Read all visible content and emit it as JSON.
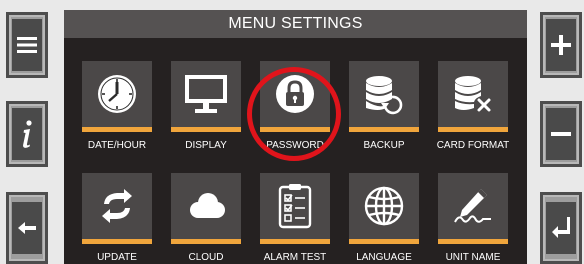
{
  "title": "MENU SETTINGS",
  "colors": {
    "accent_bar": "#f0a53c",
    "highlight_ring": "#e0141b",
    "screen_background": "#252121",
    "tile_background": "#4b4848"
  },
  "side_buttons": {
    "left": [
      {
        "icon": "menu-icon"
      },
      {
        "icon": "info-icon"
      },
      {
        "icon": "back-arrow-icon"
      }
    ],
    "right": [
      {
        "icon": "plus-icon"
      },
      {
        "icon": "minus-icon"
      },
      {
        "icon": "enter-icon"
      }
    ]
  },
  "tiles": [
    {
      "label": "DATE/HOUR",
      "icon": "clock-icon"
    },
    {
      "label": "DISPLAY",
      "icon": "monitor-icon"
    },
    {
      "label": "PASSWORD",
      "icon": "lock-icon",
      "highlighted": true
    },
    {
      "label": "BACKUP",
      "icon": "database-restore-icon"
    },
    {
      "label": "CARD FORMAT",
      "icon": "database-delete-icon"
    },
    {
      "label": "UPDATE",
      "icon": "refresh-icon"
    },
    {
      "label": "CLOUD",
      "icon": "cloud-icon"
    },
    {
      "label": "ALARM TEST",
      "icon": "alarm-checklist-icon"
    },
    {
      "label": "LANGUAGE",
      "icon": "globe-icon"
    },
    {
      "label": "UNIT NAME",
      "icon": "signature-icon"
    }
  ]
}
